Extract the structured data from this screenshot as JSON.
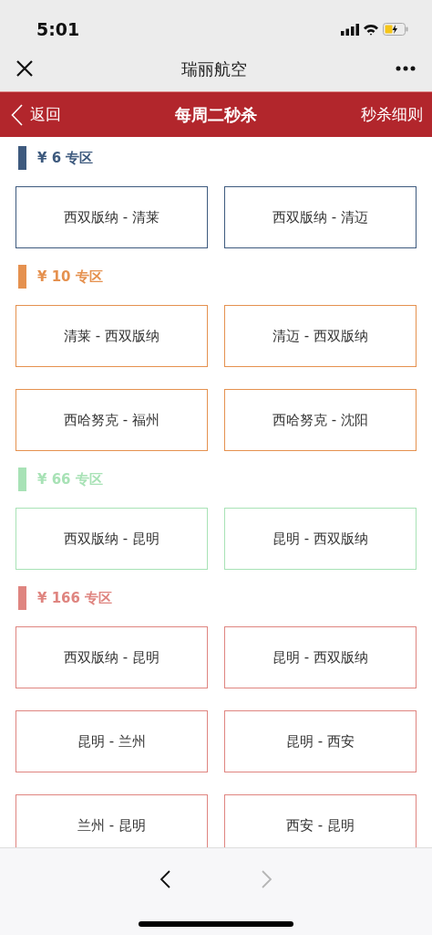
{
  "status_bar": {
    "time": "5:01"
  },
  "nav": {
    "title": "瑞丽航空"
  },
  "header": {
    "back": "返回",
    "title": "每周二秒杀",
    "link": "秒杀细则"
  },
  "sections": [
    {
      "label": "¥ 6 专区",
      "color": "#3e5a7e",
      "routes": [
        "西双版纳 - 清莱",
        "西双版纳 - 清迈"
      ]
    },
    {
      "label": "¥ 10 专区",
      "color": "#e5914f",
      "routes": [
        "清莱 - 西双版纳",
        "清迈 - 西双版纳",
        "西哈努克 - 福州",
        "西哈努克 - 沈阳"
      ]
    },
    {
      "label": "¥ 66 专区",
      "color": "#a8e2b6",
      "routes": [
        "西双版纳 - 昆明",
        "昆明 - 西双版纳"
      ]
    },
    {
      "label": "¥ 166 专区",
      "color": "#df8580",
      "routes": [
        "西双版纳 - 昆明",
        "昆明 - 西双版纳",
        "昆明 - 兰州",
        "昆明 - 西安",
        "兰州 - 昆明",
        "西安 - 昆明"
      ]
    }
  ],
  "toolbar": {
    "back": {
      "disabled": false
    },
    "forward": {
      "disabled": true
    }
  }
}
